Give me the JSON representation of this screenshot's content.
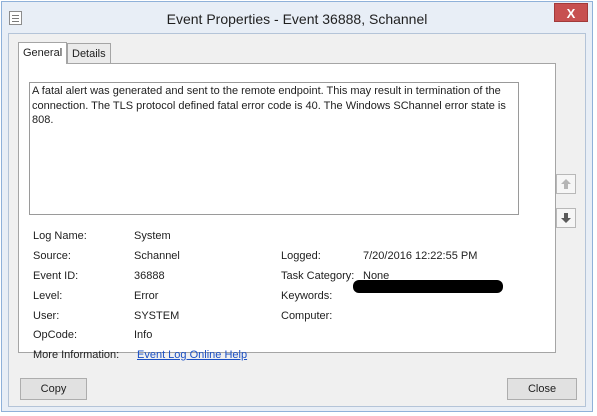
{
  "window": {
    "title": "Event Properties - Event 36888, Schannel",
    "close_glyph": "X"
  },
  "tabs": [
    {
      "label": "General",
      "selected": true
    },
    {
      "label": "Details",
      "selected": false
    }
  ],
  "description": "A fatal alert was generated and sent to the remote endpoint. This may result in termination of the connection. The TLS protocol defined fatal error code is 40. The Windows SChannel error state is 808.",
  "fields": {
    "log_name": {
      "label": "Log Name:",
      "value": "System"
    },
    "source": {
      "label": "Source:",
      "value": "Schannel"
    },
    "logged": {
      "label": "Logged:",
      "value": "7/20/2016 12:22:55 PM"
    },
    "event_id": {
      "label": "Event ID:",
      "value": "36888"
    },
    "task_category": {
      "label": "Task Category:",
      "value": "None"
    },
    "level": {
      "label": "Level:",
      "value": "Error"
    },
    "keywords": {
      "label": "Keywords:",
      "value": ""
    },
    "user": {
      "label": "User:",
      "value": "SYSTEM"
    },
    "computer": {
      "label": "Computer:",
      "value": ""
    },
    "opcode": {
      "label": "OpCode:",
      "value": "Info"
    },
    "more_info": {
      "label": "More Information:",
      "value": "Event Log Online Help"
    }
  },
  "nav": {
    "up_icon": "arrow-up-icon",
    "down_icon": "arrow-down-icon",
    "up_enabled": false
  },
  "buttons": {
    "copy": "Copy",
    "close": "Close"
  },
  "colors": {
    "close_button": "#c75050",
    "link": "#1a4fc4",
    "window_border": "#8fb1d9"
  }
}
